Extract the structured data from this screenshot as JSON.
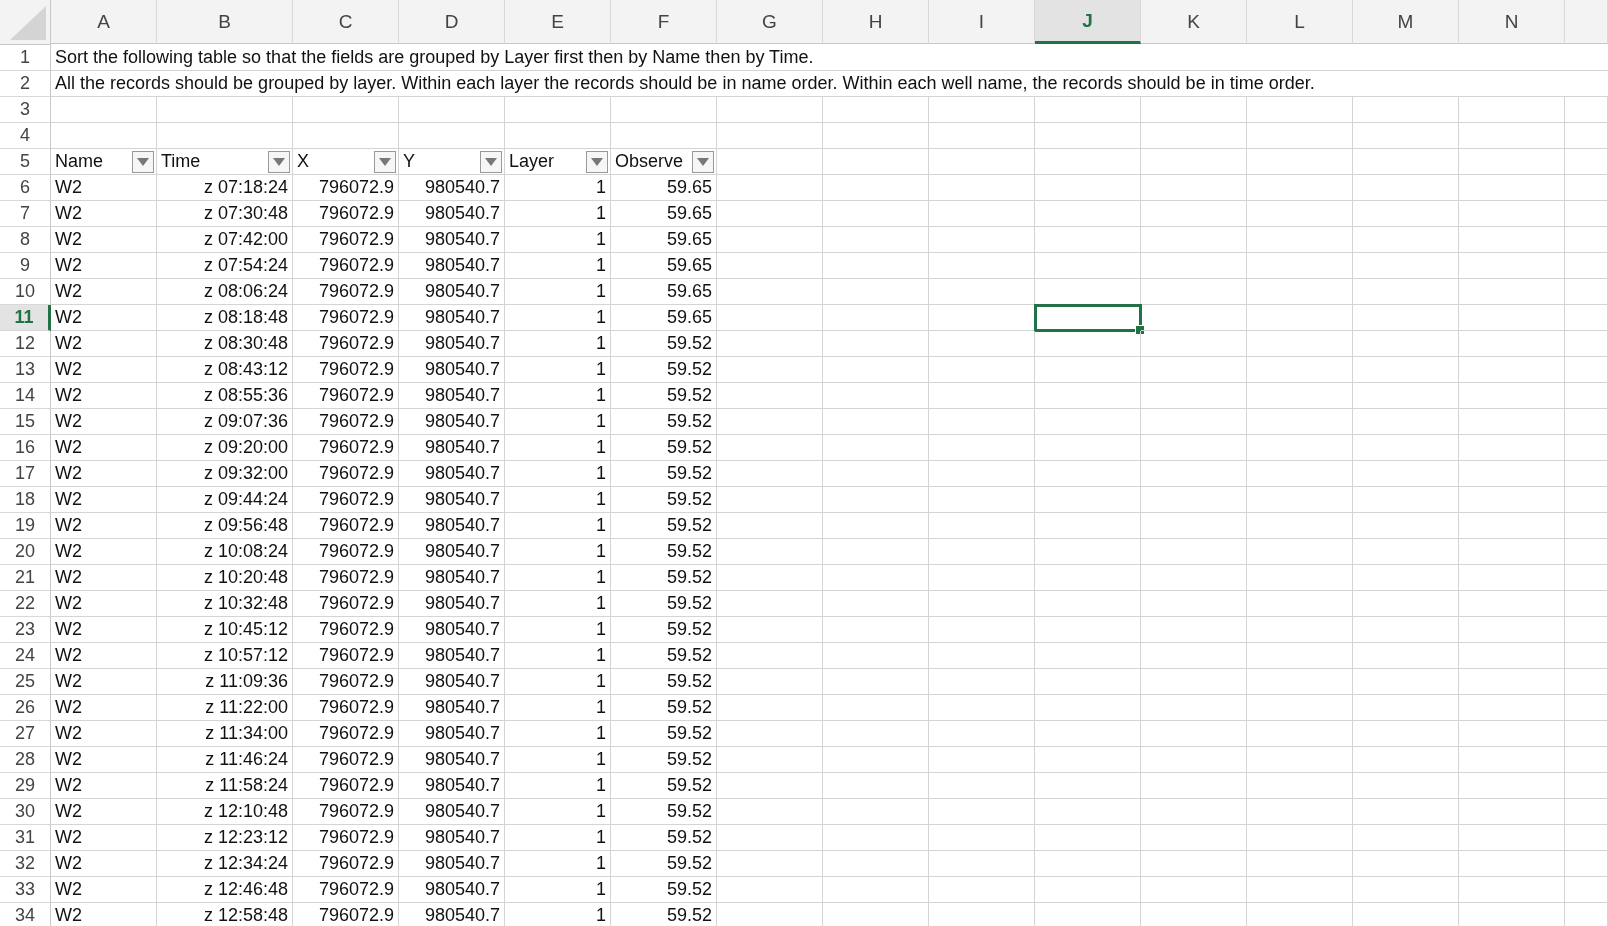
{
  "columns": [
    {
      "label": "A",
      "selected": false
    },
    {
      "label": "B",
      "selected": false
    },
    {
      "label": "C",
      "selected": false
    },
    {
      "label": "D",
      "selected": false
    },
    {
      "label": "E",
      "selected": false
    },
    {
      "label": "F",
      "selected": false
    },
    {
      "label": "G",
      "selected": false
    },
    {
      "label": "H",
      "selected": false
    },
    {
      "label": "I",
      "selected": false
    },
    {
      "label": "J",
      "selected": true
    },
    {
      "label": "K",
      "selected": false
    },
    {
      "label": "L",
      "selected": false
    },
    {
      "label": "M",
      "selected": false
    },
    {
      "label": "N",
      "selected": false
    }
  ],
  "rows": [
    {
      "number": "1",
      "selected": false,
      "kind": "note",
      "text": "Sort the following table so that the fields are grouped by Layer first then by Name then by Time."
    },
    {
      "number": "2",
      "selected": false,
      "kind": "note",
      "text": "All the records should be grouped by layer. Within each layer the records should be in name order. Within each well name, the records should be in time order."
    },
    {
      "number": "3",
      "selected": false,
      "kind": "blank"
    },
    {
      "number": "4",
      "selected": false,
      "kind": "blank"
    },
    {
      "number": "5",
      "selected": false,
      "kind": "header",
      "cells": [
        "Name",
        "Time",
        "X",
        "Y",
        "Layer",
        "Observe"
      ]
    },
    {
      "number": "6",
      "selected": false,
      "kind": "data",
      "cells": [
        "W2",
        "z 07:18:24",
        "796072.9",
        "980540.7",
        "1",
        "59.65"
      ]
    },
    {
      "number": "7",
      "selected": false,
      "kind": "data",
      "cells": [
        "W2",
        "z 07:30:48",
        "796072.9",
        "980540.7",
        "1",
        "59.65"
      ]
    },
    {
      "number": "8",
      "selected": false,
      "kind": "data",
      "cells": [
        "W2",
        "z 07:42:00",
        "796072.9",
        "980540.7",
        "1",
        "59.65"
      ]
    },
    {
      "number": "9",
      "selected": false,
      "kind": "data",
      "cells": [
        "W2",
        "z 07:54:24",
        "796072.9",
        "980540.7",
        "1",
        "59.65"
      ]
    },
    {
      "number": "10",
      "selected": false,
      "kind": "data",
      "cells": [
        "W2",
        "z 08:06:24",
        "796072.9",
        "980540.7",
        "1",
        "59.65"
      ]
    },
    {
      "number": "11",
      "selected": true,
      "kind": "data",
      "cells": [
        "W2",
        "z 08:18:48",
        "796072.9",
        "980540.7",
        "1",
        "59.65"
      ]
    },
    {
      "number": "12",
      "selected": false,
      "kind": "data",
      "cells": [
        "W2",
        "z 08:30:48",
        "796072.9",
        "980540.7",
        "1",
        "59.52"
      ]
    },
    {
      "number": "13",
      "selected": false,
      "kind": "data",
      "cells": [
        "W2",
        "z 08:43:12",
        "796072.9",
        "980540.7",
        "1",
        "59.52"
      ]
    },
    {
      "number": "14",
      "selected": false,
      "kind": "data",
      "cells": [
        "W2",
        "z 08:55:36",
        "796072.9",
        "980540.7",
        "1",
        "59.52"
      ]
    },
    {
      "number": "15",
      "selected": false,
      "kind": "data",
      "cells": [
        "W2",
        "z 09:07:36",
        "796072.9",
        "980540.7",
        "1",
        "59.52"
      ]
    },
    {
      "number": "16",
      "selected": false,
      "kind": "data",
      "cells": [
        "W2",
        "z 09:20:00",
        "796072.9",
        "980540.7",
        "1",
        "59.52"
      ]
    },
    {
      "number": "17",
      "selected": false,
      "kind": "data",
      "cells": [
        "W2",
        "z 09:32:00",
        "796072.9",
        "980540.7",
        "1",
        "59.52"
      ]
    },
    {
      "number": "18",
      "selected": false,
      "kind": "data",
      "cells": [
        "W2",
        "z 09:44:24",
        "796072.9",
        "980540.7",
        "1",
        "59.52"
      ]
    },
    {
      "number": "19",
      "selected": false,
      "kind": "data",
      "cells": [
        "W2",
        "z 09:56:48",
        "796072.9",
        "980540.7",
        "1",
        "59.52"
      ]
    },
    {
      "number": "20",
      "selected": false,
      "kind": "data",
      "cells": [
        "W2",
        "z 10:08:24",
        "796072.9",
        "980540.7",
        "1",
        "59.52"
      ]
    },
    {
      "number": "21",
      "selected": false,
      "kind": "data",
      "cells": [
        "W2",
        "z 10:20:48",
        "796072.9",
        "980540.7",
        "1",
        "59.52"
      ]
    },
    {
      "number": "22",
      "selected": false,
      "kind": "data",
      "cells": [
        "W2",
        "z 10:32:48",
        "796072.9",
        "980540.7",
        "1",
        "59.52"
      ]
    },
    {
      "number": "23",
      "selected": false,
      "kind": "data",
      "cells": [
        "W2",
        "z 10:45:12",
        "796072.9",
        "980540.7",
        "1",
        "59.52"
      ]
    },
    {
      "number": "24",
      "selected": false,
      "kind": "data",
      "cells": [
        "W2",
        "z 10:57:12",
        "796072.9",
        "980540.7",
        "1",
        "59.52"
      ]
    },
    {
      "number": "25",
      "selected": false,
      "kind": "data",
      "cells": [
        "W2",
        "z 11:09:36",
        "796072.9",
        "980540.7",
        "1",
        "59.52"
      ]
    },
    {
      "number": "26",
      "selected": false,
      "kind": "data",
      "cells": [
        "W2",
        "z 11:22:00",
        "796072.9",
        "980540.7",
        "1",
        "59.52"
      ]
    },
    {
      "number": "27",
      "selected": false,
      "kind": "data",
      "cells": [
        "W2",
        "z 11:34:00",
        "796072.9",
        "980540.7",
        "1",
        "59.52"
      ]
    },
    {
      "number": "28",
      "selected": false,
      "kind": "data",
      "cells": [
        "W2",
        "z 11:46:24",
        "796072.9",
        "980540.7",
        "1",
        "59.52"
      ]
    },
    {
      "number": "29",
      "selected": false,
      "kind": "data",
      "cells": [
        "W2",
        "z 11:58:24",
        "796072.9",
        "980540.7",
        "1",
        "59.52"
      ]
    },
    {
      "number": "30",
      "selected": false,
      "kind": "data",
      "cells": [
        "W2",
        "z 12:10:48",
        "796072.9",
        "980540.7",
        "1",
        "59.52"
      ]
    },
    {
      "number": "31",
      "selected": false,
      "kind": "data",
      "cells": [
        "W2",
        "z 12:23:12",
        "796072.9",
        "980540.7",
        "1",
        "59.52"
      ]
    },
    {
      "number": "32",
      "selected": false,
      "kind": "data",
      "cells": [
        "W2",
        "z 12:34:24",
        "796072.9",
        "980540.7",
        "1",
        "59.52"
      ]
    },
    {
      "number": "33",
      "selected": false,
      "kind": "data",
      "cells": [
        "W2",
        "z 12:46:48",
        "796072.9",
        "980540.7",
        "1",
        "59.52"
      ]
    },
    {
      "number": "34",
      "selected": false,
      "kind": "data",
      "cells": [
        "W2",
        "z 12:58:48",
        "796072.9",
        "980540.7",
        "1",
        "59.52"
      ]
    }
  ]
}
